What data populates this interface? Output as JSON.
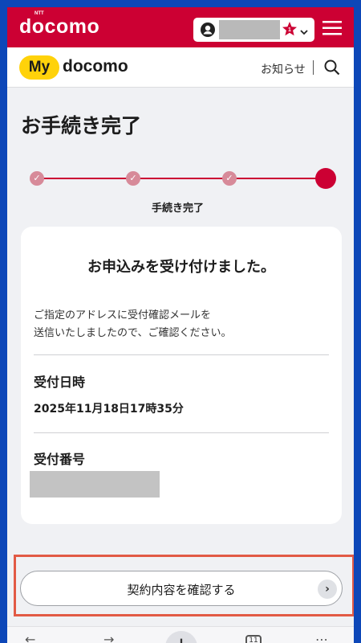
{
  "topbar": {
    "brand": "docomo",
    "brand_sup": "NTT"
  },
  "header": {
    "logo_my": "My",
    "logo_docomo": "docomo",
    "notice_link": "お知らせ"
  },
  "page": {
    "title": "お手続き完了"
  },
  "stepper": {
    "current_label": "手続き完了",
    "steps_total": 4,
    "steps_completed": 3
  },
  "card": {
    "heading": "お申込みを受け付けました。",
    "message_line1": "ご指定のアドレスに受付確認メールを",
    "message_line2": "送信いたしましたので、ご確認ください。",
    "date_label": "受付日時",
    "date_value": "2025年11月18日17時35分",
    "number_label": "受付番号"
  },
  "actions": {
    "confirm_label": "契約内容を確認する"
  },
  "browser": {
    "tab_count": "11"
  },
  "colors": {
    "brand_red": "#cc0033",
    "step_done": "#d78a99",
    "logo_yellow": "#ffd20a",
    "highlight": "#e25a45"
  }
}
